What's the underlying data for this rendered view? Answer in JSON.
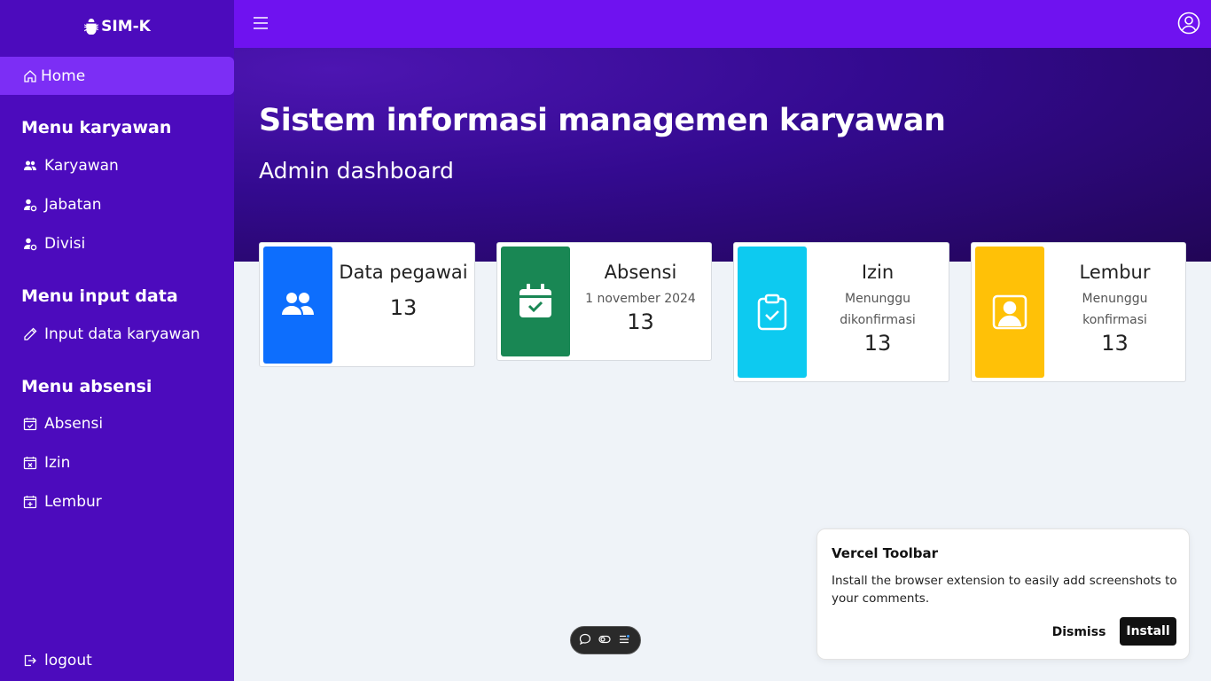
{
  "brand": {
    "name": "SIM-K",
    "icon": "bug-icon"
  },
  "sidebar": {
    "home": {
      "label": "Home",
      "icon": "home-icon"
    },
    "sections": [
      {
        "title": "Menu karyawan",
        "items": [
          {
            "label": "Karyawan",
            "icon": "people-icon"
          },
          {
            "label": "Jabatan",
            "icon": "person-gear-icon"
          },
          {
            "label": "Divisi",
            "icon": "person-gear-icon"
          }
        ]
      },
      {
        "title": "Menu input data",
        "items": [
          {
            "label": "Input data karyawan",
            "icon": "pencil-icon"
          }
        ]
      },
      {
        "title": "Menu absensi",
        "items": [
          {
            "label": "Absensi",
            "icon": "calendar-check-icon"
          },
          {
            "label": "Izin",
            "icon": "calendar-x-icon"
          },
          {
            "label": "Lembur",
            "icon": "calendar-plus-icon"
          }
        ]
      }
    ],
    "logout": {
      "label": "logout",
      "icon": "logout-icon"
    }
  },
  "hero": {
    "title": "Sistem informasi managemen karyawan",
    "subtitle": "Admin dashboard"
  },
  "cards": [
    {
      "title": "Data pegawai",
      "subtitle": "",
      "value": "13",
      "color": "#0d6efd",
      "icon": "people-icon"
    },
    {
      "title": "Absensi",
      "subtitle": "1 november 2024",
      "value": "13",
      "color": "#198754",
      "icon": "calendar-check-icon"
    },
    {
      "title": "Izin",
      "subtitle": "Menunggu dikonfirmasi",
      "value": "13",
      "color": "#0dcaf0",
      "icon": "clipboard-check-icon"
    },
    {
      "title": "Lembur",
      "subtitle": "Menunggu konfirmasi",
      "value": "13",
      "color": "#ffc107",
      "icon": "person-square-icon"
    }
  ],
  "vercel": {
    "title": "Vercel Toolbar",
    "text": "Install the browser extension to easily add screenshots to your comments.",
    "dismiss": "Dismiss",
    "install": "Install"
  },
  "colors": {
    "sidebar": "#4c0bbd",
    "topbar": "#6f12f0",
    "active": "#7c2ef5"
  }
}
